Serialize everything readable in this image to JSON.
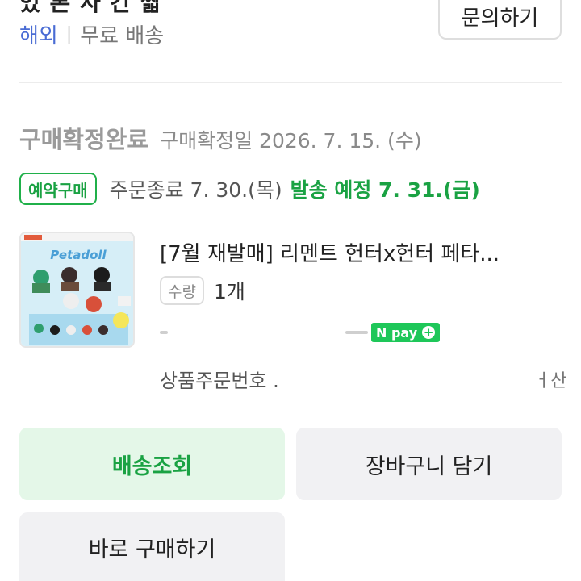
{
  "top": {
    "cut_text": "었 본 사 간 짧"
  },
  "origin": {
    "overseas": "해외",
    "separator": "|",
    "shipping": "무료 배송"
  },
  "inquiry_button": "문의하기",
  "purchase": {
    "status": "구매확정완료",
    "confirm_date": "구매확정일 2026. 7. 15. (수)"
  },
  "reservation": {
    "badge": "예약구매",
    "order_end": "주문종료 7. 30.(목)",
    "ship_schedule": "발송 예정 7. 31.(금)"
  },
  "product": {
    "name": "[7월 재발매] 리멘트 헌터x헌터 페타...",
    "thumb_logo": "Petadoll",
    "qty_label": "수량",
    "qty_value": "1개"
  },
  "payment": {
    "npay": "N pay",
    "plus": "+"
  },
  "order": {
    "number_label": "상품주문번호 .",
    "tail": "ㅓ산"
  },
  "buttons": {
    "track": "배송조회",
    "cart": "장바구니 담기",
    "buy_now": "바로 구매하기"
  },
  "colors": {
    "green": "#1aa243",
    "blue_link": "#4a6cd4",
    "light_green_bg": "#e4f7e8",
    "gray_bg": "#f1f1f3",
    "npay_green": "#1ec759"
  }
}
